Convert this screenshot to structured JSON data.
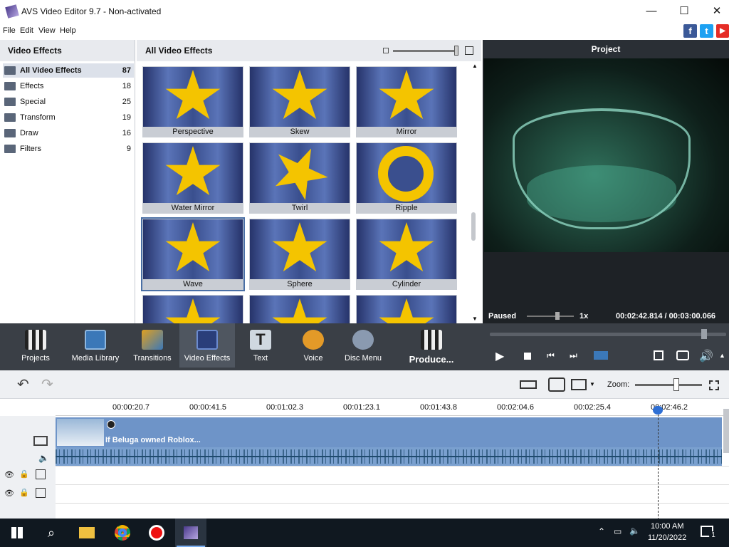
{
  "window": {
    "title": "AVS Video Editor 9.7 - Non-activated",
    "minimize": "—",
    "maximize": "☐",
    "close": "✕"
  },
  "menu": [
    "File",
    "Edit",
    "View",
    "Help"
  ],
  "social": [
    {
      "name": "facebook-icon",
      "glyph": "f",
      "color": "#3b5998"
    },
    {
      "name": "twitter-icon",
      "glyph": "t",
      "color": "#1da1f2"
    },
    {
      "name": "youtube-icon",
      "glyph": "▶",
      "color": "#e52d27"
    }
  ],
  "left_panel": {
    "title": "Video Effects",
    "categories": [
      {
        "label": "All Video Effects",
        "count": "87"
      },
      {
        "label": "Effects",
        "count": "18"
      },
      {
        "label": "Special",
        "count": "25"
      },
      {
        "label": "Transform",
        "count": "19"
      },
      {
        "label": "Draw",
        "count": "16"
      },
      {
        "label": "Filters",
        "count": "9"
      }
    ]
  },
  "effects_panel": {
    "title": "All Video Effects",
    "items": [
      "Perspective",
      "Skew",
      "Mirror",
      "Water Mirror",
      "Twirl",
      "Ripple",
      "Wave",
      "Sphere",
      "Cylinder",
      "",
      "",
      ""
    ]
  },
  "preview": {
    "title": "Project",
    "status": "Paused",
    "speed": "1x",
    "time": "00:02:42.814 / 00:03:00.066"
  },
  "toolbar": [
    "Projects",
    "Media Library",
    "Transitions",
    "Video Effects",
    "Text",
    "Voice",
    "Disc Menu",
    "Produce..."
  ],
  "timeline": {
    "zoom_label": "Zoom:",
    "ticks": [
      "00:00:20.7",
      "00:00:41.5",
      "00:01:02.3",
      "00:01:23.1",
      "00:01:43.8",
      "00:02:04.6",
      "00:02:25.4",
      "00:02:46.2"
    ],
    "clip_title": "If Beluga owned Roblox..."
  },
  "taskbar": {
    "time": "10:00 AM",
    "date": "11/20/2022",
    "notifications": "1"
  }
}
